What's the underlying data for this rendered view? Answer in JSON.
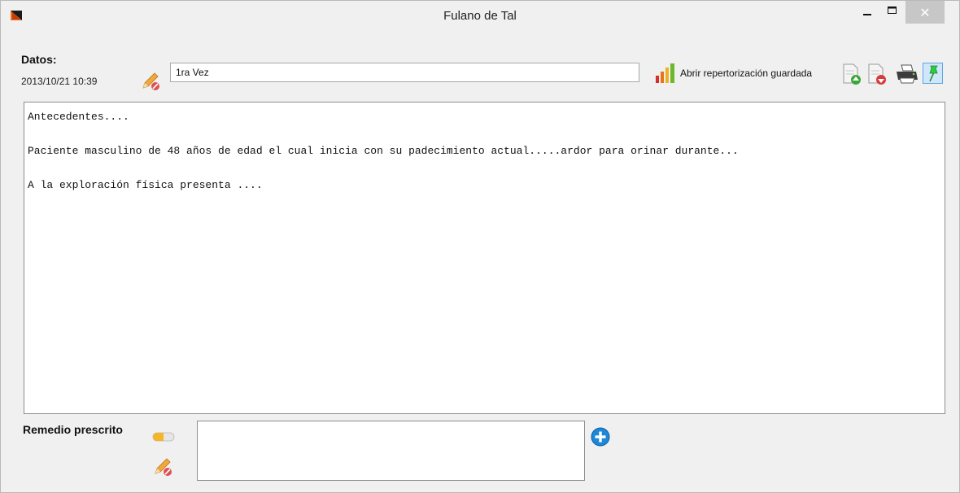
{
  "window": {
    "title": "Fulano de Tal",
    "close_glyph": "✕"
  },
  "header": {
    "datos_label": "Datos:",
    "timestamp": "2013/10/21 10:39",
    "consulta_tipo_value": "1ra Vez",
    "open_saved_label": "Abrir repertorización guardada"
  },
  "notes": {
    "lines": [
      "Antecedentes....",
      "",
      "Paciente masculino de 48 años de edad el cual inicia con su padecimiento actual.....ardor para orinar durante...",
      "",
      "A la exploración física presenta ...."
    ]
  },
  "prescription": {
    "label": "Remedio prescrito",
    "value": ""
  },
  "icons": {
    "app": "app-icon",
    "edit": "pencil-edit-icon",
    "repertorization": "bar-chart-icon",
    "import": "document-add-icon",
    "export": "document-remove-icon",
    "print": "printer-icon",
    "pin": "pushpin-icon",
    "remedy": "pill-icon",
    "add": "plus-circle-icon"
  },
  "colors": {
    "accent_blue": "#1e88d8",
    "pin_green": "#2ecc40",
    "close_bg": "#c7c7c7"
  }
}
